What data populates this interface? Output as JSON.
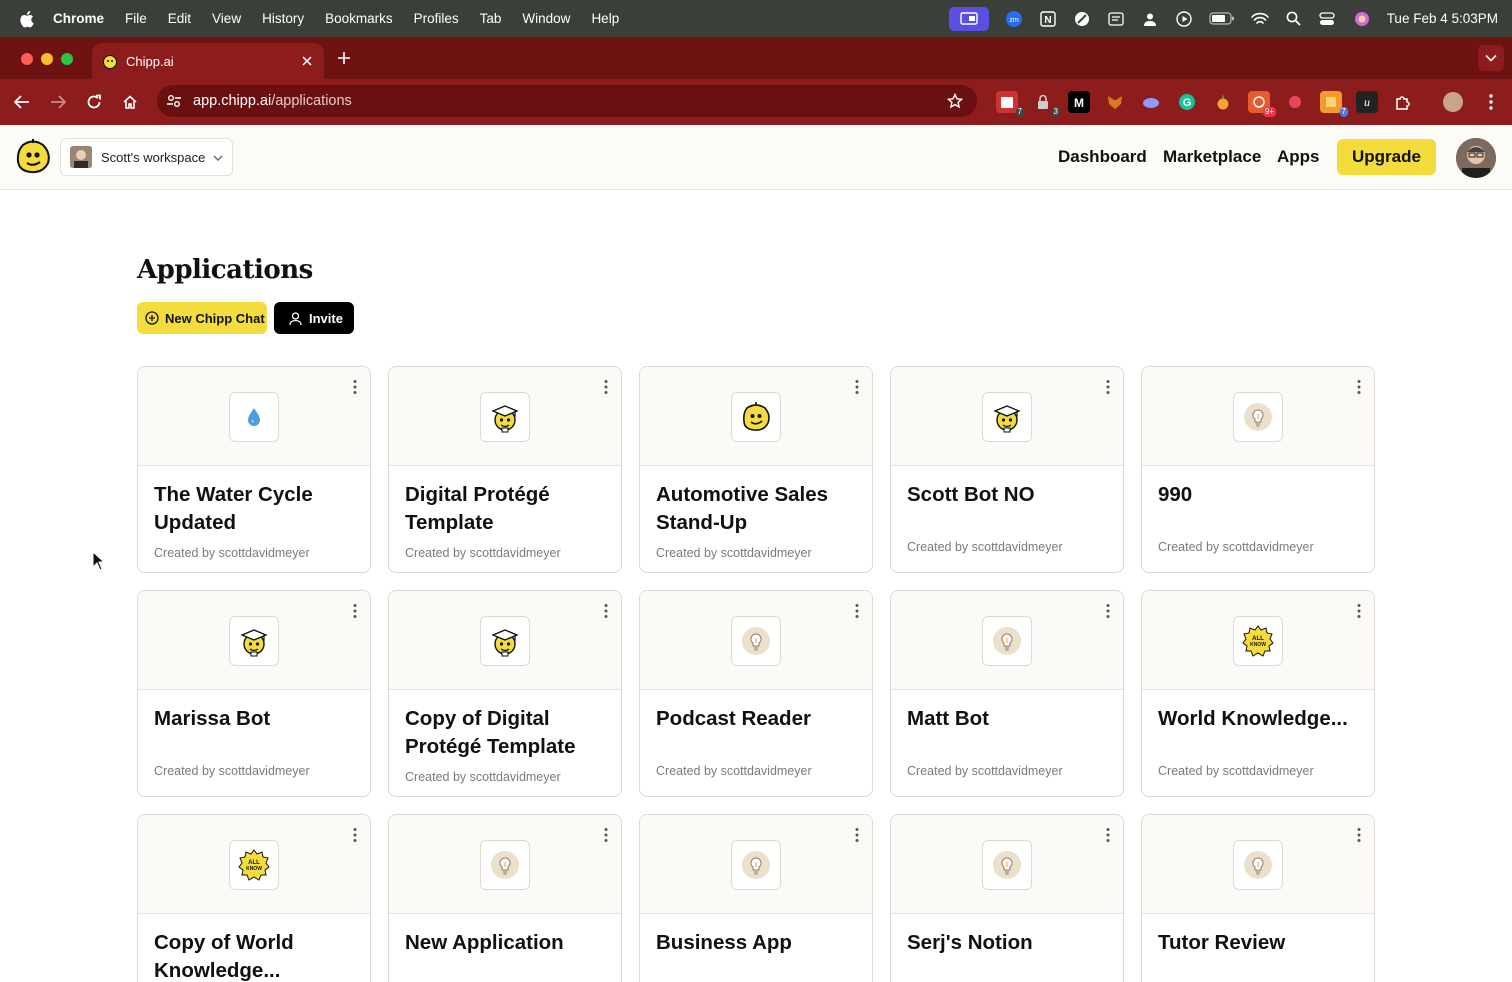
{
  "menubar": {
    "items": [
      "Chrome",
      "File",
      "Edit",
      "View",
      "History",
      "Bookmarks",
      "Profiles",
      "Tab",
      "Window",
      "Help"
    ],
    "clock": "Tue Feb 4  5:03PM"
  },
  "browser": {
    "tab_title": "Chipp.ai",
    "url_host": "app.chipp.ai",
    "url_path": "/applications",
    "extension_badges": [
      "7",
      "3",
      "9+",
      "7"
    ]
  },
  "header": {
    "workspace": "Scott's workspace",
    "nav": [
      "Dashboard",
      "Marketplace",
      "Apps"
    ],
    "upgrade": "Upgrade"
  },
  "main": {
    "title": "Applications",
    "new_button": "New Chipp Chat",
    "invite_button": "Invite",
    "apps": [
      {
        "title": "The Water Cycle Updated",
        "created": "Created by scottdavidmeyer",
        "icon": "water-drop-icon"
      },
      {
        "title": "Digital Protégé Template",
        "created": "Created by scottdavidmeyer",
        "icon": "graduate-mascot-icon"
      },
      {
        "title": "Automotive Sales Stand-Up",
        "created": "Created by scottdavidmeyer",
        "icon": "chipp-mascot-icon"
      },
      {
        "title": "Scott Bot NO",
        "created": "Created by scottdavidmeyer",
        "icon": "graduate-mascot-icon"
      },
      {
        "title": "990",
        "created": "Created by scottdavidmeyer",
        "icon": "lightbulb-icon"
      },
      {
        "title": "Marissa Bot",
        "created": "Created by scottdavidmeyer",
        "icon": "graduate-mascot-icon"
      },
      {
        "title": "Copy of Digital Protégé Template",
        "created": "Created by scottdavidmeyer",
        "icon": "graduate-mascot-icon"
      },
      {
        "title": "Podcast Reader",
        "created": "Created by scottdavidmeyer",
        "icon": "lightbulb-icon"
      },
      {
        "title": "Matt Bot",
        "created": "Created by scottdavidmeyer",
        "icon": "lightbulb-icon"
      },
      {
        "title": "World Knowledge...",
        "created": "Created by scottdavidmeyer",
        "icon": "all-knowing-badge-icon"
      },
      {
        "title": "Copy of World Knowledge...",
        "created": "",
        "icon": "all-knowing-badge-icon"
      },
      {
        "title": "New Application",
        "created": "",
        "icon": "lightbulb-icon"
      },
      {
        "title": "Business App",
        "created": "",
        "icon": "lightbulb-icon"
      },
      {
        "title": "Serj's Notion",
        "created": "",
        "icon": "lightbulb-icon"
      },
      {
        "title": "Tutor Review",
        "created": "",
        "icon": "lightbulb-icon"
      }
    ]
  },
  "colors": {
    "tab_strip": "#6e1212",
    "toolbar": "#8d1c1c",
    "accent_yellow": "#f4dc3c",
    "menubar": "#3a3f3a"
  }
}
